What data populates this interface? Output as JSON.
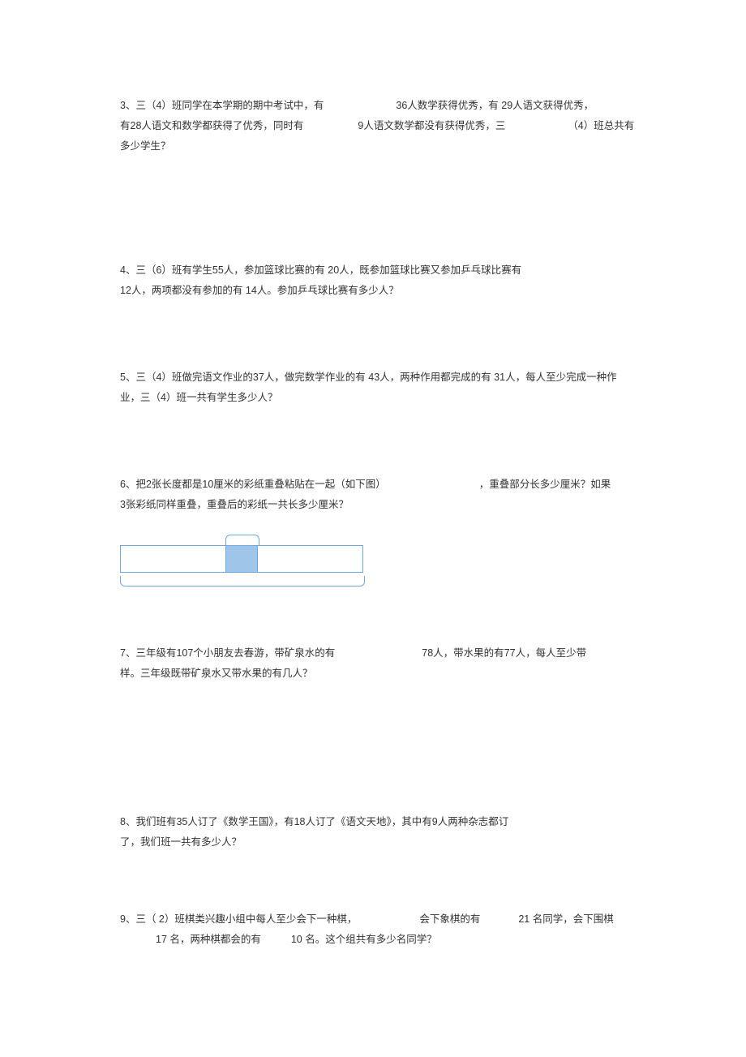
{
  "q3": {
    "l1a": "3、三（4）班同学在本学期的期中考试中，有",
    "l1b": "36人数学获得优秀，有 29人语文获得优秀，",
    "l2a": "有28人语文和数学都获得了优秀，同时有",
    "l2b": "9人语文数学都没有获得优秀，三",
    "l2c": "（4）班总共有",
    "l3": "多少学生？"
  },
  "q4": {
    "l1": "4、三（6）班有学生55人，参加篮球比赛的有 20人，既参加篮球比赛又参加乒乓球比赛有",
    "l2": "12人，两项都没有参加的有 14人。参加乒乓球比赛有多少人？"
  },
  "q5": {
    "l1": "5、三（4）班做完语文作业的37人，做完数学作业的有 43人，两种作用都完成的有 31人，每人至少完成一种作",
    "l2": "业，三（4）班一共有学生多少人？"
  },
  "q6": {
    "l1a": "6、把2张长度都是10厘米的彩纸重叠粘贴在一起（如下图）",
    "l1b": "，重叠部分长多少厘米？如果",
    "l2": "3张彩纸同样重叠，重叠后的彩纸一共长多少厘米？"
  },
  "q7": {
    "l1a": "7、三年级有107个小朋友去春游，带矿泉水的有",
    "l1b": "78人，带水果的有77人，每人至少带",
    "l2": "样。三年级既带矿泉水又带水果的有几人？"
  },
  "q8": {
    "l1": "8、我们班有35人订了《数学王国》，有18人订了《语文天地》，其中有9人两种杂志都订",
    "l2": "了，我们班一共有多少人？"
  },
  "q9": {
    "l1a": "9、三（    2）班棋类兴趣小组中每人至少会下一种棋，",
    "l1b": "会下象棋的有",
    "l1c": "21 名同学，会下围棋",
    "l2a": "17 名，两种棋都会的有",
    "l2b": "10 名。这个组共有多少名同学？"
  }
}
